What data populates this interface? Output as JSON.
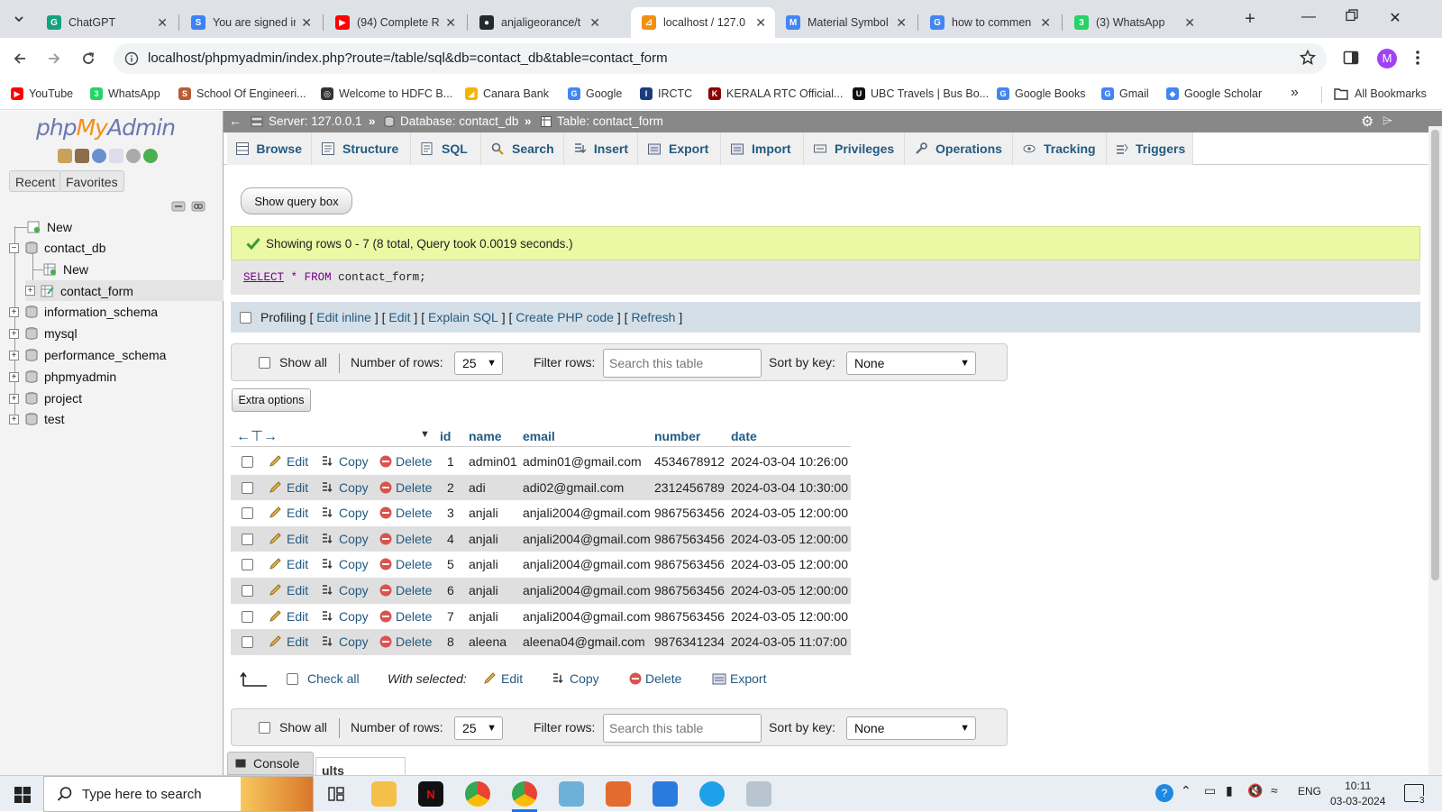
{
  "browser": {
    "tabs": [
      {
        "title": "ChatGPT",
        "color": "#10a37f",
        "glyph": "G"
      },
      {
        "title": "You are signed in",
        "color": "#3b82f6",
        "glyph": "S"
      },
      {
        "title": "(94) Complete R",
        "color": "#ff0000",
        "glyph": "▶"
      },
      {
        "title": "anjaligeorance/t",
        "color": "#24292f",
        "glyph": "●"
      },
      {
        "title": "localhost / 127.0",
        "color": "#f29111",
        "glyph": "⊿"
      },
      {
        "title": "Material Symbol",
        "color": "#4285f4",
        "glyph": "M"
      },
      {
        "title": "how to commen",
        "color": "#4285f4",
        "glyph": "G"
      },
      {
        "title": "(3) WhatsApp",
        "color": "#25d366",
        "glyph": "3"
      }
    ],
    "new_tab": "+",
    "url": "localhost/phpmyadmin/index.php?route=/table/sql&db=contact_db&table=contact_form",
    "avatar_letter": "M",
    "bookmarks": [
      {
        "label": "YouTube",
        "color": "#ff0000",
        "glyph": "▶"
      },
      {
        "label": "WhatsApp",
        "color": "#25d366",
        "glyph": "3"
      },
      {
        "label": "School Of Engineeri...",
        "color": "#b85c38",
        "glyph": "S"
      },
      {
        "label": "Welcome to HDFC B...",
        "color": "#333",
        "glyph": "◎"
      },
      {
        "label": "Canara Bank",
        "color": "#f4b400",
        "glyph": "◢"
      },
      {
        "label": "Google",
        "color": "#4285f4",
        "glyph": "G"
      },
      {
        "label": "IRCTC",
        "color": "#1a3c7d",
        "glyph": "I"
      },
      {
        "label": "KERALA RTC Official...",
        "color": "#8b0000",
        "glyph": "K"
      },
      {
        "label": "UBC Travels | Bus Bo...",
        "color": "#111",
        "glyph": "U"
      },
      {
        "label": "Google Books",
        "color": "#4285f4",
        "glyph": "G"
      },
      {
        "label": "Gmail",
        "color": "#4285f4",
        "glyph": "G"
      },
      {
        "label": "Google Scholar",
        "color": "#4285f4",
        "glyph": "◆"
      }
    ],
    "bookmarks_more": "»",
    "all_bookmarks": "All Bookmarks"
  },
  "sidebar": {
    "logo_php": "php",
    "logo_my": "My",
    "logo_admin": "Admin",
    "tabs": [
      "Recent",
      "Favorites"
    ],
    "tree": [
      {
        "label": "New"
      },
      {
        "label": "contact_db"
      },
      {
        "label": "New"
      },
      {
        "label": "contact_form"
      },
      {
        "label": "information_schema"
      },
      {
        "label": "mysql"
      },
      {
        "label": "performance_schema"
      },
      {
        "label": "phpmyadmin"
      },
      {
        "label": "project"
      },
      {
        "label": "test"
      }
    ]
  },
  "breadcrumb": {
    "server": "Server: 127.0.0.1",
    "database": "Database: contact_db",
    "table": "Table: contact_form",
    "separator": "»"
  },
  "menu": [
    "Browse",
    "Structure",
    "SQL",
    "Search",
    "Insert",
    "Export",
    "Import",
    "Privileges",
    "Operations",
    "Tracking",
    "Triggers"
  ],
  "query": {
    "show_query_box": "Show query box",
    "success": "Showing rows 0 - 7 (8 total, Query took 0.0019 seconds.)",
    "sql_select": "SELECT",
    "sql_star": "*",
    "sql_from": "FROM",
    "sql_table": "contact_form;"
  },
  "profiling": {
    "label": "Profiling",
    "links": [
      "Edit inline",
      "Edit",
      "Explain SQL",
      "Create PHP code",
      "Refresh"
    ]
  },
  "nav": {
    "show_all": "Show all",
    "rows_label": "Number of rows:",
    "rows_value": "25",
    "filter_label": "Filter rows:",
    "filter_placeholder": "Search this table",
    "sort_label": "Sort by key:",
    "sort_value": "None"
  },
  "extra_options": "Extra options",
  "table": {
    "columns": [
      "id",
      "name",
      "email",
      "number",
      "date"
    ],
    "actions": {
      "edit": "Edit",
      "copy": "Copy",
      "delete": "Delete"
    },
    "rows": [
      [
        "1",
        "admin01",
        "admin01@gmail.com",
        "4534678912",
        "2024-03-04 10:26:00"
      ],
      [
        "2",
        "adi",
        "adi02@gmail.com",
        "2312456789",
        "2024-03-04 10:30:00"
      ],
      [
        "3",
        "anjali",
        "anjali2004@gmail.com",
        "9867563456",
        "2024-03-05 12:00:00"
      ],
      [
        "4",
        "anjali",
        "anjali2004@gmail.com",
        "9867563456",
        "2024-03-05 12:00:00"
      ],
      [
        "5",
        "anjali",
        "anjali2004@gmail.com",
        "9867563456",
        "2024-03-05 12:00:00"
      ],
      [
        "6",
        "anjali",
        "anjali2004@gmail.com",
        "9867563456",
        "2024-03-05 12:00:00"
      ],
      [
        "7",
        "anjali",
        "anjali2004@gmail.com",
        "9867563456",
        "2024-03-05 12:00:00"
      ],
      [
        "8",
        "aleena",
        "aleena04@gmail.com",
        "9876341234",
        "2024-03-05 11:07:00"
      ]
    ]
  },
  "bulk": {
    "check_all": "Check all",
    "with_selected": "With selected:",
    "edit": "Edit",
    "copy": "Copy",
    "delete": "Delete",
    "export": "Export"
  },
  "console": "Console",
  "peek_text": "ults operations",
  "taskbar": {
    "search_placeholder": "Type here to search",
    "lang": "ENG",
    "time": "10:11",
    "date": "03-03-2024",
    "notif_count": "3"
  }
}
